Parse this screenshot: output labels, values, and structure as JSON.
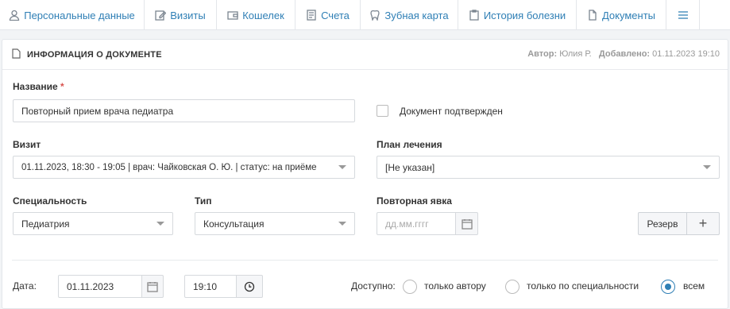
{
  "tabs": [
    {
      "label": "Персональные данные",
      "icon": "user-icon"
    },
    {
      "label": "Визиты",
      "icon": "edit-icon"
    },
    {
      "label": "Кошелек",
      "icon": "wallet-icon"
    },
    {
      "label": "Счета",
      "icon": "invoice-icon"
    },
    {
      "label": "Зубная карта",
      "icon": "tooth-icon"
    },
    {
      "label": "История болезни",
      "icon": "clipboard-icon"
    },
    {
      "label": "Документы",
      "icon": "document-icon"
    }
  ],
  "menu_icon": "hamburger-menu-icon",
  "card": {
    "title": "ИНФОРМАЦИЯ О ДОКУМЕНТЕ",
    "author_label": "Автор:",
    "author": "Юлия Р.",
    "added_label": "Добавлено:",
    "added": "01.11.2023 19:10"
  },
  "form": {
    "name_label": "Название",
    "name_required": "*",
    "name_value": "Повторный прием врача педиатра",
    "confirmed_label": "Документ подтвержден",
    "visit_label": "Визит",
    "visit_value": "01.11.2023, 18:30 - 19:05 | врач: Чайковская О. Ю. | статус: на приёме",
    "plan_label": "План лечения",
    "plan_value": "[Не указан]",
    "specialty_label": "Специальность",
    "specialty_value": "Педиатрия",
    "type_label": "Тип",
    "type_value": "Консультация",
    "repeat_label": "Повторная явка",
    "repeat_placeholder": "дд.мм.гггг",
    "reserve_label": "Резерв",
    "plus_label": "+",
    "date_label": "Дата:",
    "date_value": "01.11.2023",
    "time_value": "19:10",
    "access_label": "Доступно:",
    "access_options": [
      "только автору",
      "только по специальности",
      "всем"
    ],
    "access_selected": "всем"
  },
  "colors": {
    "accent": "#2f7fb5",
    "required": "#d9534f"
  }
}
